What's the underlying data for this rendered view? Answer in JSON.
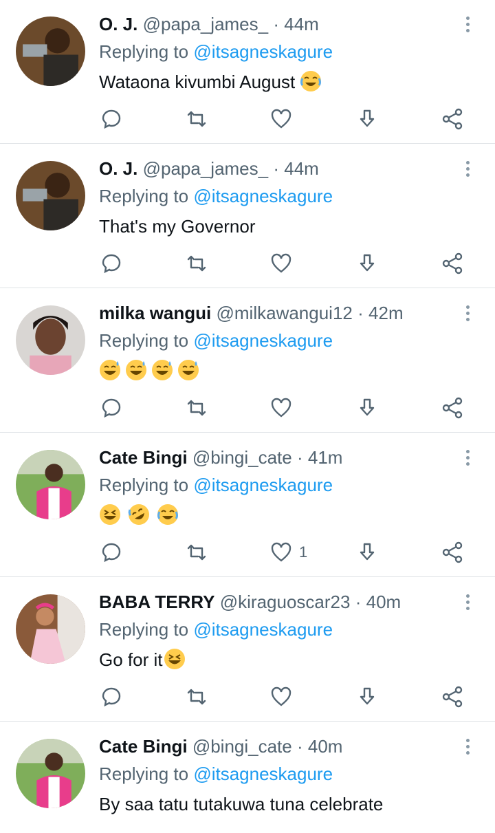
{
  "tweets": [
    {
      "name": "O. J.",
      "handle": "@papa_james_",
      "time": "44m",
      "reply_prefix": "Replying to",
      "reply_to": "@itsagneskagure",
      "text": "Wataona kivumbi August",
      "emojis": [
        "face-with-tears-of-joy"
      ],
      "like_count": ""
    },
    {
      "name": "O. J.",
      "handle": "@papa_james_",
      "time": "44m",
      "reply_prefix": "Replying to",
      "reply_to": "@itsagneskagure",
      "text": "That's my Governor",
      "emojis": [],
      "like_count": ""
    },
    {
      "name": "milka wangui",
      "handle": "@milkawangui12",
      "time": "42m",
      "reply_prefix": "Replying to",
      "reply_to": "@itsagneskagure",
      "text": "",
      "emojis": [
        "grinning-sweat",
        "grinning-sweat",
        "grinning-sweat",
        "grinning-sweat"
      ],
      "like_count": ""
    },
    {
      "name": "Cate Bingi",
      "handle": "@bingi_cate",
      "time": "41m",
      "reply_prefix": "Replying to",
      "reply_to": "@itsagneskagure",
      "text": "",
      "emojis": [
        "grinning-squinting",
        "rolling-on-floor-laughing",
        "face-with-tears-of-joy"
      ],
      "like_count": "1"
    },
    {
      "name": "BABA TERRY",
      "handle": "@kiraguoscar23",
      "time": "40m",
      "reply_prefix": "Replying to",
      "reply_to": "@itsagneskagure",
      "text": "Go for it",
      "emojis": [
        "grinning-squinting"
      ],
      "like_count": ""
    },
    {
      "name": "Cate Bingi",
      "handle": "@bingi_cate",
      "time": "40m",
      "reply_prefix": "Replying to",
      "reply_to": "@itsagneskagure",
      "text": "By saa tatu tutakuwa tuna celebrate",
      "emojis": [],
      "like_count": ""
    }
  ],
  "separator": "·",
  "icons": {
    "reply": "reply-icon",
    "retweet": "retweet-icon",
    "like": "heart-icon",
    "bookmark": "download-icon",
    "share": "share-icon",
    "more": "more-vertical-icon"
  },
  "colors": {
    "text": "#0f1419",
    "muted": "#536471",
    "mention": "#1d9bf0",
    "icon": "#536471",
    "divider": "#dfe3e6"
  }
}
